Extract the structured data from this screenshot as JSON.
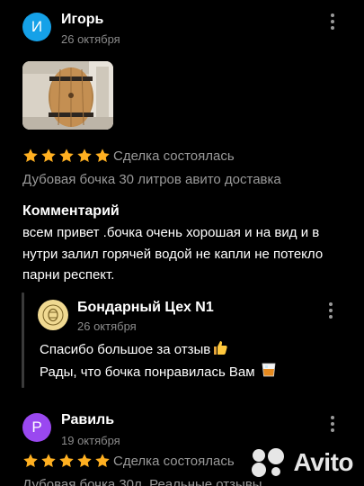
{
  "reviews": [
    {
      "avatar_letter": "И",
      "avatar_color": "#15a1e8",
      "author": "Игорь",
      "date": "26 октября",
      "rating": 5,
      "deal_status": "Сделка состоялась",
      "item_title": "Дубовая бочка 30 литров авито доставка",
      "comment_heading": "Комментарий",
      "comment_text": "всем привет .бочка очень хорошая и на вид и в нутри залил горячей водой не капли не потекло парни респект.",
      "reply": {
        "seller_name": "Бондарный Цех N1",
        "date": "26 октября",
        "line1": "Спасибо большое за отзыв",
        "line2": "Рады, что бочка понравилась Вам"
      }
    },
    {
      "avatar_letter": "Р",
      "avatar_color": "#9a48f0",
      "author": "Равиль",
      "date": "19 октября",
      "rating": 5,
      "deal_status": "Сделка состоялась",
      "item_title": "Дубовая бочка 30л. Реальные отзывы"
    }
  ],
  "star_color": "#ffb021",
  "watermark": "Avito"
}
